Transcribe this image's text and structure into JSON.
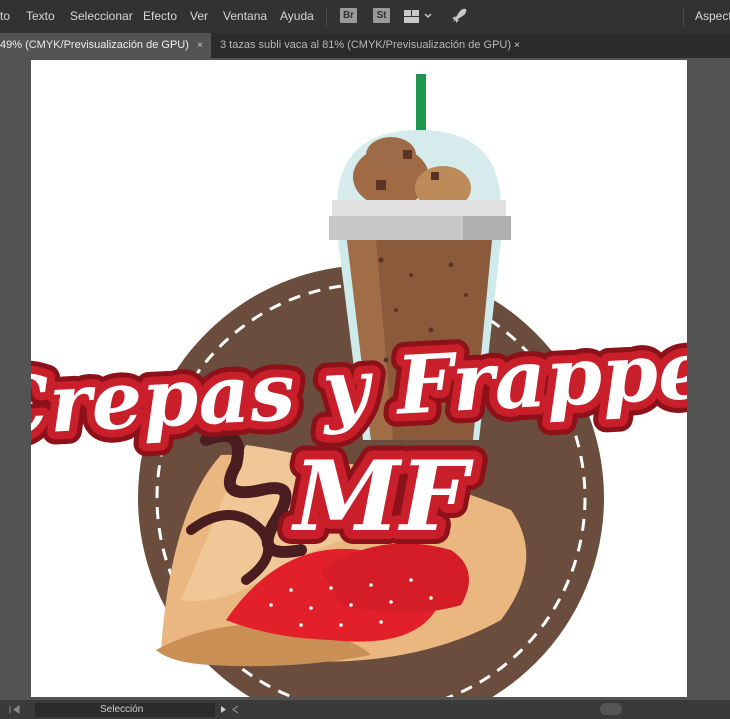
{
  "menubar": {
    "items": [
      "to",
      "Texto",
      "Seleccionar",
      "Efecto",
      "Ver",
      "Ventana",
      "Ayuda"
    ],
    "icons": [
      "Br",
      "St"
    ],
    "right_label": "Aspect"
  },
  "tabs": [
    {
      "label": "49% (CMYK/Previsualización de GPU)",
      "close": "×"
    },
    {
      "label": "3 tazas subli vaca al 81% (CMYK/Previsualización de GPU)",
      "close": "×"
    }
  ],
  "artwork": {
    "line1": "Crepas y Frappes",
    "line2": "MF"
  },
  "statusbar": {
    "tool_label": "Selección"
  },
  "colors": {
    "brown_circle": "#6b4d3e",
    "crepe_dark": "#c98f55",
    "crepe_light": "#f0c898",
    "chocolate": "#4a1d20",
    "strawberry": "#e2202a",
    "text_fill": "#ffffff",
    "text_outline_red": "#c91f2a",
    "text_outline_dark": "#8c1119",
    "cup_body": "#8b5a3a",
    "lid": "#c7c7c7",
    "dome": "#d6ecec",
    "straw": "#1e9650"
  }
}
